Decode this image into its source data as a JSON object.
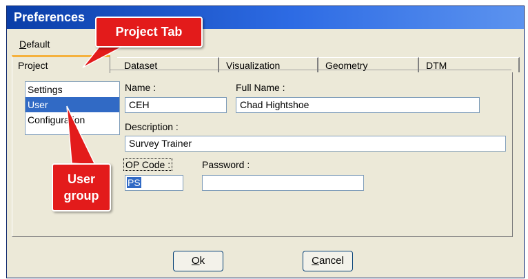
{
  "window": {
    "title": "Preferences"
  },
  "menu": {
    "default_label": "Default",
    "default_mnemonic": "D",
    "default_rest": "efault"
  },
  "tabs": {
    "active": "Project",
    "items": [
      "Dataset",
      "Visualization",
      "Geometry",
      "DTM"
    ]
  },
  "list": {
    "items": [
      {
        "label": "Settings",
        "selected": false
      },
      {
        "label": "User",
        "selected": true
      },
      {
        "label": "Configuration",
        "selected": false
      }
    ]
  },
  "form": {
    "name_label": "Name :",
    "name_value": "CEH",
    "fullname_label": "Full Name :",
    "fullname_value": "Chad Hightshoe",
    "description_label": "Description :",
    "description_value": "Survey Trainer",
    "opcode_label": "OP Code :",
    "opcode_value": "PS",
    "password_label": "Password :",
    "password_value": ""
  },
  "buttons": {
    "ok_mnemonic": "O",
    "ok_rest": "k",
    "cancel_mnemonic": "C",
    "cancel_rest": "ancel"
  },
  "callouts": {
    "project_tab": "Project Tab",
    "user_group_line1": "User",
    "user_group_line2": "group"
  },
  "colors": {
    "titlebar": "#0a3ea8",
    "selection": "#316ac5",
    "active_tab_accent": "#f5b13d",
    "callout": "#e31b1b",
    "dialog_bg": "#ece9d8"
  }
}
